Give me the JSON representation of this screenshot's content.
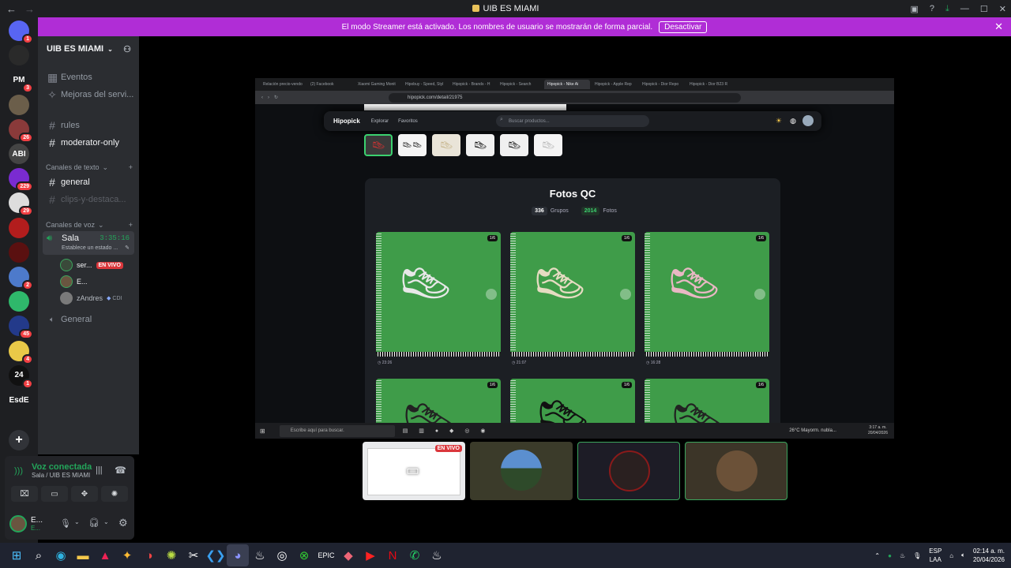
{
  "window": {
    "title": "UIB ES MIAMI"
  },
  "streamer_bar": {
    "text": "El modo Streamer está activado. Los nombres de usuario se mostrarán de forma parcial.",
    "button": "Desactivar"
  },
  "guilds": [
    {
      "label": "",
      "badge": "1",
      "color": "#5865f2"
    },
    {
      "label": "",
      "badge": "",
      "color": "#2a2a2a"
    },
    {
      "label": "PM",
      "badge": "3",
      "color": "#1e1f22"
    },
    {
      "label": "",
      "badge": "",
      "color": "#6b5e4a"
    },
    {
      "label": "",
      "badge": "26",
      "color": "#8a3a3a"
    },
    {
      "label": "ABI",
      "badge": "",
      "color": "#444"
    },
    {
      "label": "",
      "badge": "229",
      "color": "#7a2bd1"
    },
    {
      "label": "",
      "badge": "29",
      "color": "#ddd"
    },
    {
      "label": "",
      "badge": "",
      "color": "#b21d1d"
    },
    {
      "label": "",
      "badge": "",
      "color": "#5a1010"
    },
    {
      "label": "",
      "badge": "2",
      "color": "#4d7acb"
    },
    {
      "label": "",
      "badge": "",
      "color": "#2fb86b"
    },
    {
      "label": "",
      "badge": "45",
      "color": "#233a8a"
    },
    {
      "label": "",
      "badge": "4",
      "color": "#e9c948"
    },
    {
      "label": "24",
      "badge": "1",
      "color": "#111"
    },
    {
      "label": "EsdE",
      "badge": "",
      "color": "#1e1f22"
    }
  ],
  "server": {
    "name": "UIB ES MIAMI"
  },
  "channels_top": [
    {
      "icon": "▦",
      "label": "Eventos"
    },
    {
      "icon": "✧",
      "label": "Mejoras del servi..."
    }
  ],
  "channels_misc": [
    {
      "label": "rules"
    },
    {
      "label": "moderator-only"
    }
  ],
  "text_category": "Canales de texto",
  "text_channels": [
    {
      "label": "general"
    },
    {
      "label": "clips-y-destaca..."
    }
  ],
  "voice_category": "Canales de voz",
  "voice_channel": {
    "label": "Sala",
    "timer": "3:35:16",
    "status": "Establece un estado ..."
  },
  "voice_users": [
    {
      "name": "ser...",
      "live": "EN VIVO"
    },
    {
      "name": "E...",
      "live": ""
    },
    {
      "name": "zAndres",
      "live": "",
      "extra": "CDI"
    }
  ],
  "voice_channel_2": {
    "label": "General"
  },
  "voice_panel": {
    "status": "Voz conectada",
    "location": "Sala / UIB ES MIAMI"
  },
  "user_panel": {
    "name": "E...",
    "sub": "E..."
  },
  "browser": {
    "tabs": [
      "Relación precio-vendo",
      "(2) Facebook",
      "Xiaomi Gaming Monit",
      "Hipobuy - Speed, Styl",
      "Hipopick - Brands - H",
      "Hipopick - Search",
      "Hipopick - Nike Ai",
      "Hipopick - Apple Rep",
      "Hipopick - Dior Repo",
      "Hipopick - Dior B23 R"
    ],
    "active_tab": 6,
    "url": "hipopick.com/detail/21975"
  },
  "site": {
    "logo": "Hipopick",
    "links": [
      "Explorar",
      "Favoritos"
    ],
    "search_placeholder": "Buscar productos..."
  },
  "qc": {
    "title": "Fotos QC",
    "groups_num": "336",
    "groups_label": "Grupos",
    "photos_num": "2014",
    "photos_label": "Fotos",
    "photos": [
      {
        "count": "1/6",
        "time": "23:26"
      },
      {
        "count": "1/6",
        "time": "21:07"
      },
      {
        "count": "1/6",
        "time": "16:28"
      },
      {
        "count": "1/6",
        "time": ""
      },
      {
        "count": "1/6",
        "time": ""
      },
      {
        "count": "1/6",
        "time": ""
      }
    ]
  },
  "win_taskbar": {
    "search": "Escribe aquí para buscar.",
    "weather": "26°C  Mayorm. nubla...",
    "time": "3:17 a. m.",
    "date": "20/04/2026"
  },
  "tiles": {
    "live": "EN VIVO"
  },
  "taskbar": {
    "lang1": "ESP",
    "lang2": "LAA",
    "time": "02:14 a. m.",
    "date": "20/04/2026"
  }
}
